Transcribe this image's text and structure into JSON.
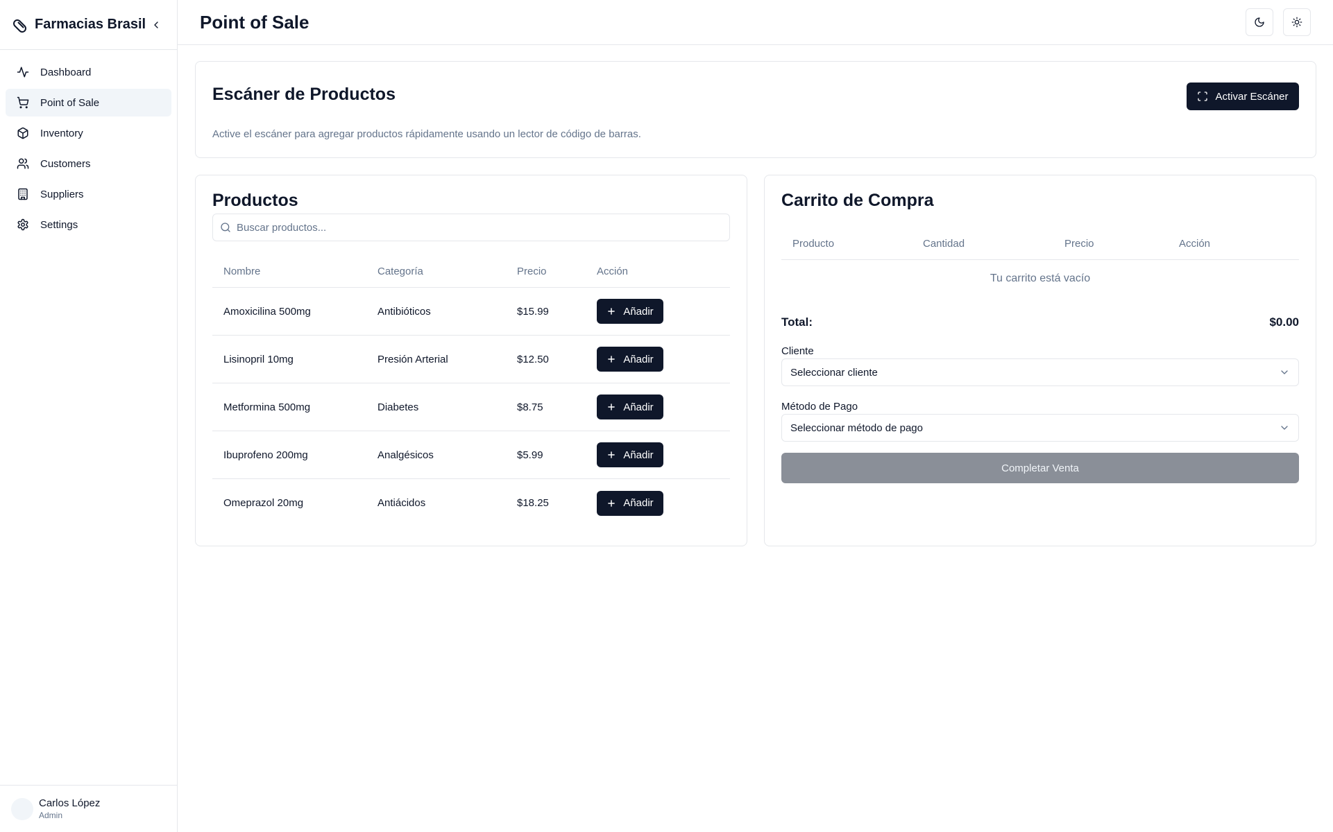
{
  "app": {
    "brand": "Farmacias Brasil",
    "page_title": "Point of Sale"
  },
  "sidebar": {
    "items": [
      {
        "label": "Dashboard",
        "icon": "activity-icon",
        "active": false
      },
      {
        "label": "Point of Sale",
        "icon": "cart-icon",
        "active": true
      },
      {
        "label": "Inventory",
        "icon": "package-icon",
        "active": false
      },
      {
        "label": "Customers",
        "icon": "users-icon",
        "active": false
      },
      {
        "label": "Suppliers",
        "icon": "building-icon",
        "active": false
      },
      {
        "label": "Settings",
        "icon": "gear-icon",
        "active": false
      }
    ],
    "user": {
      "name": "Carlos López",
      "role": "Admin"
    }
  },
  "scanner": {
    "title": "Escáner de Productos",
    "description": "Active el escáner para agregar productos rápidamente usando un lector de código de barras.",
    "button_label": "Activar Escáner"
  },
  "products": {
    "title": "Productos",
    "search_placeholder": "Buscar productos...",
    "columns": [
      "Nombre",
      "Categoría",
      "Precio",
      "Acción"
    ],
    "add_label": "Añadir",
    "rows": [
      {
        "name": "Amoxicilina 500mg",
        "category": "Antibióticos",
        "price": "$15.99"
      },
      {
        "name": "Lisinopril 10mg",
        "category": "Presión Arterial",
        "price": "$12.50"
      },
      {
        "name": "Metformina 500mg",
        "category": "Diabetes",
        "price": "$8.75"
      },
      {
        "name": "Ibuprofeno 200mg",
        "category": "Analgésicos",
        "price": "$5.99"
      },
      {
        "name": "Omeprazol 20mg",
        "category": "Antiácidos",
        "price": "$18.25"
      }
    ]
  },
  "cart": {
    "title": "Carrito de Compra",
    "columns": [
      "Producto",
      "Cantidad",
      "Precio",
      "Acción"
    ],
    "empty_message": "Tu carrito está vacío",
    "total_label": "Total:",
    "total_value": "$0.00",
    "customer_label": "Cliente",
    "customer_value": "Seleccionar cliente",
    "payment_label": "Método de Pago",
    "payment_value": "Seleccionar método de pago",
    "complete_label": "Completar Venta"
  },
  "colors": {
    "primary": "#0f172a",
    "muted_text": "#64748b",
    "border": "#e5e7eb",
    "active_bg": "#f1f5f9",
    "disabled_button": "#8a8f98"
  }
}
